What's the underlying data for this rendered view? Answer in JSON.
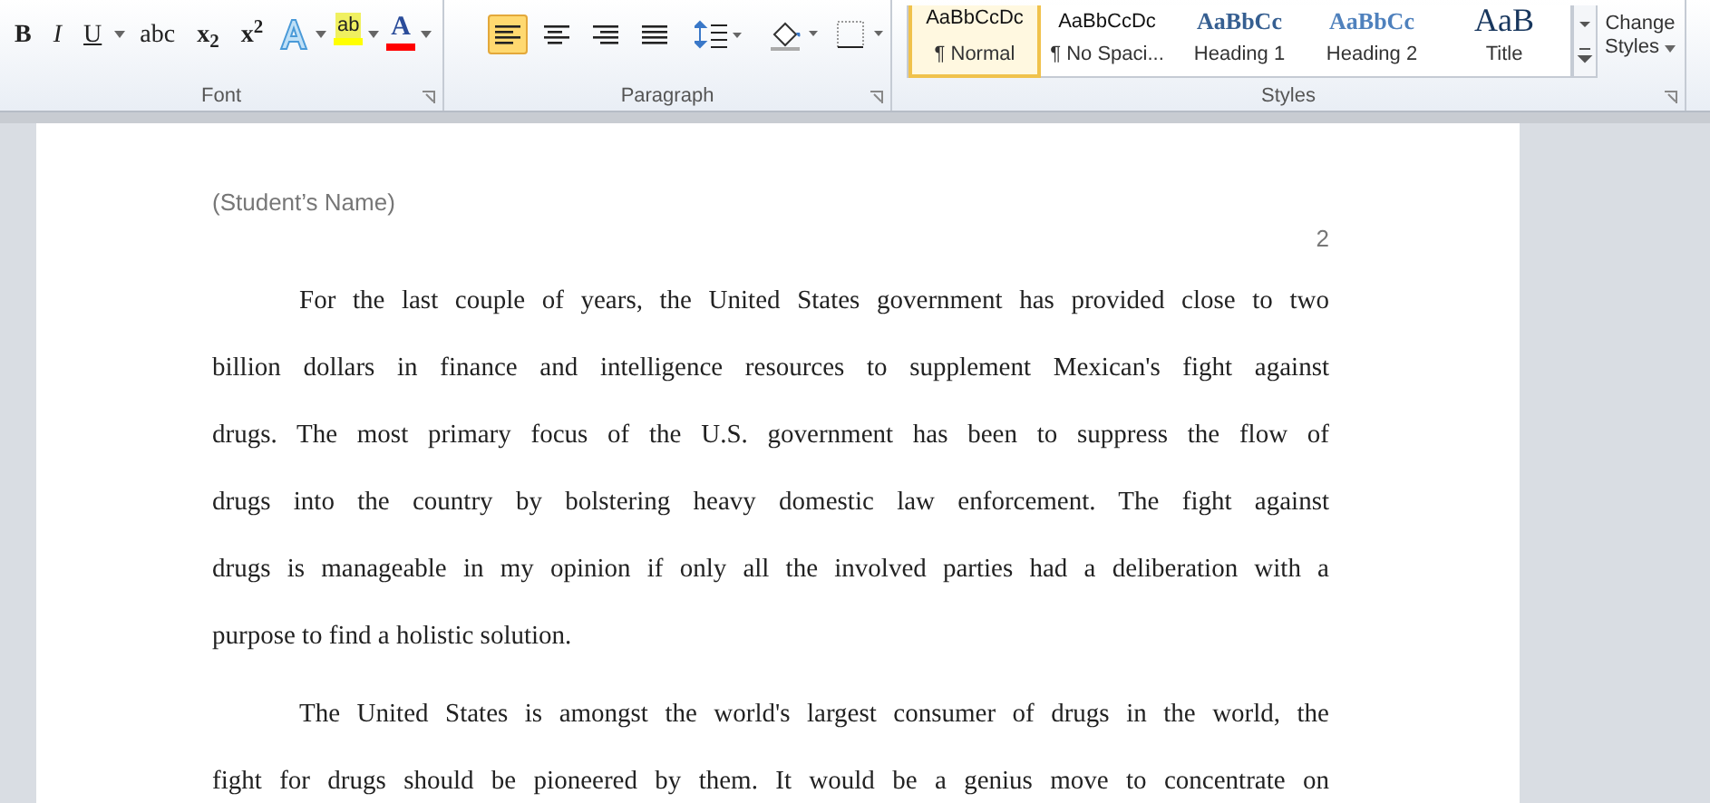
{
  "ribbon": {
    "font_group": {
      "label": "Font",
      "buttons": [
        {
          "kind": "bold",
          "label": "B"
        },
        {
          "kind": "italic",
          "label": "I"
        },
        {
          "kind": "underline",
          "label": "U",
          "dropdown": true
        },
        {
          "kind": "strike",
          "label": "abc"
        },
        {
          "kind": "subscript",
          "label": "x$_{2}$"
        },
        {
          "kind": "superscript",
          "label": "x$^{2}$"
        },
        {
          "kind": "effects",
          "dropdown": true
        },
        {
          "kind": "highlight",
          "label": "ab",
          "dropdown": true
        },
        {
          "kind": "color",
          "label": "A",
          "dropdown": true
        }
      ]
    },
    "paragraph_group": {
      "label": "Paragraph",
      "align": [
        {
          "kind": "left",
          "selected": true
        },
        {
          "kind": "center",
          "selected": false
        },
        {
          "kind": "right",
          "selected": false
        },
        {
          "kind": "justify",
          "selected": false
        }
      ]
    },
    "styles_group": {
      "label": "Styles",
      "styles": [
        {
          "sample": "AaBbCcDc",
          "name": "¶ Normal",
          "kind": "normal",
          "selected": true
        },
        {
          "sample": "AaBbCcDc",
          "name": "¶ No Spaci...",
          "kind": "normal",
          "selected": false
        },
        {
          "sample": "AaBbCc",
          "name": "Heading 1",
          "kind": "heading1",
          "selected": false
        },
        {
          "sample": "AaBbCc",
          "name": "Heading 2",
          "kind": "heading2",
          "selected": false
        },
        {
          "sample": "AaB",
          "name": "Title",
          "kind": "title",
          "selected": false
        }
      ],
      "change_styles": [
        "Change",
        "Styles"
      ]
    }
  },
  "document": {
    "header": "(Student’s Name)",
    "page_number": "2",
    "paragraphs": [
      {
        "lines": [
          "For the last couple of years, the United States government has provided close to two",
          "billion dollars in finance and intelligence resources to supplement Mexican's fight against",
          "drugs. The most primary focus of the U.S. government has been to suppress the flow of",
          "drugs into the country by bolstering heavy domestic law enforcement. The fight against",
          "drugs is manageable in my opinion if only all the involved parties had a deliberation with a",
          "purpose to find a holistic solution."
        ],
        "complete": true
      },
      {
        "lines": [
          "The United States is amongst the world's largest consumer of drugs in the world, the",
          "fight for drugs should be pioneered by them. It would be a genius move to concentrate on"
        ],
        "complete": false
      }
    ]
  }
}
